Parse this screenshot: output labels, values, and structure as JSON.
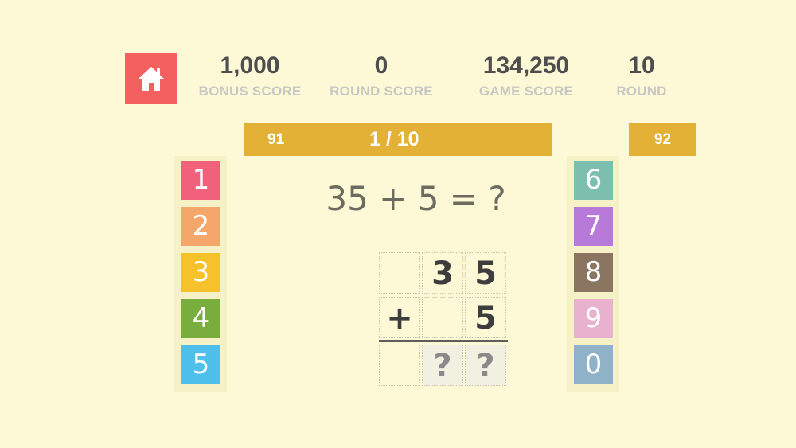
{
  "header": {
    "home_icon": "home-icon",
    "home_color": "#f2615f",
    "stats": [
      {
        "value": "1,000",
        "label": "BONUS SCORE"
      },
      {
        "value": "0",
        "label": "ROUND SCORE"
      },
      {
        "value": "134,250",
        "label": "GAME SCORE"
      },
      {
        "value": "10",
        "label": "ROUND"
      }
    ]
  },
  "progress": {
    "previous": "91",
    "current": "1 / 10",
    "next": "92",
    "bar_color": "#e3b136"
  },
  "keypad": {
    "left": [
      {
        "digit": "1",
        "color": "#f2617b"
      },
      {
        "digit": "2",
        "color": "#f5a66b"
      },
      {
        "digit": "3",
        "color": "#f5c22b"
      },
      {
        "digit": "4",
        "color": "#79ae3e"
      },
      {
        "digit": "5",
        "color": "#4fc0ec"
      }
    ],
    "right": [
      {
        "digit": "6",
        "color": "#7cbfae"
      },
      {
        "digit": "7",
        "color": "#b77ad8"
      },
      {
        "digit": "8",
        "color": "#8a7660"
      },
      {
        "digit": "9",
        "color": "#e8b2cf"
      },
      {
        "digit": "0",
        "color": "#8fb2c9"
      }
    ]
  },
  "problem": {
    "equation": "35 + 5 = ?",
    "row1": [
      "",
      "3",
      "5"
    ],
    "row2": [
      "+",
      "",
      "5"
    ],
    "answer": [
      "",
      "?",
      "?"
    ]
  }
}
